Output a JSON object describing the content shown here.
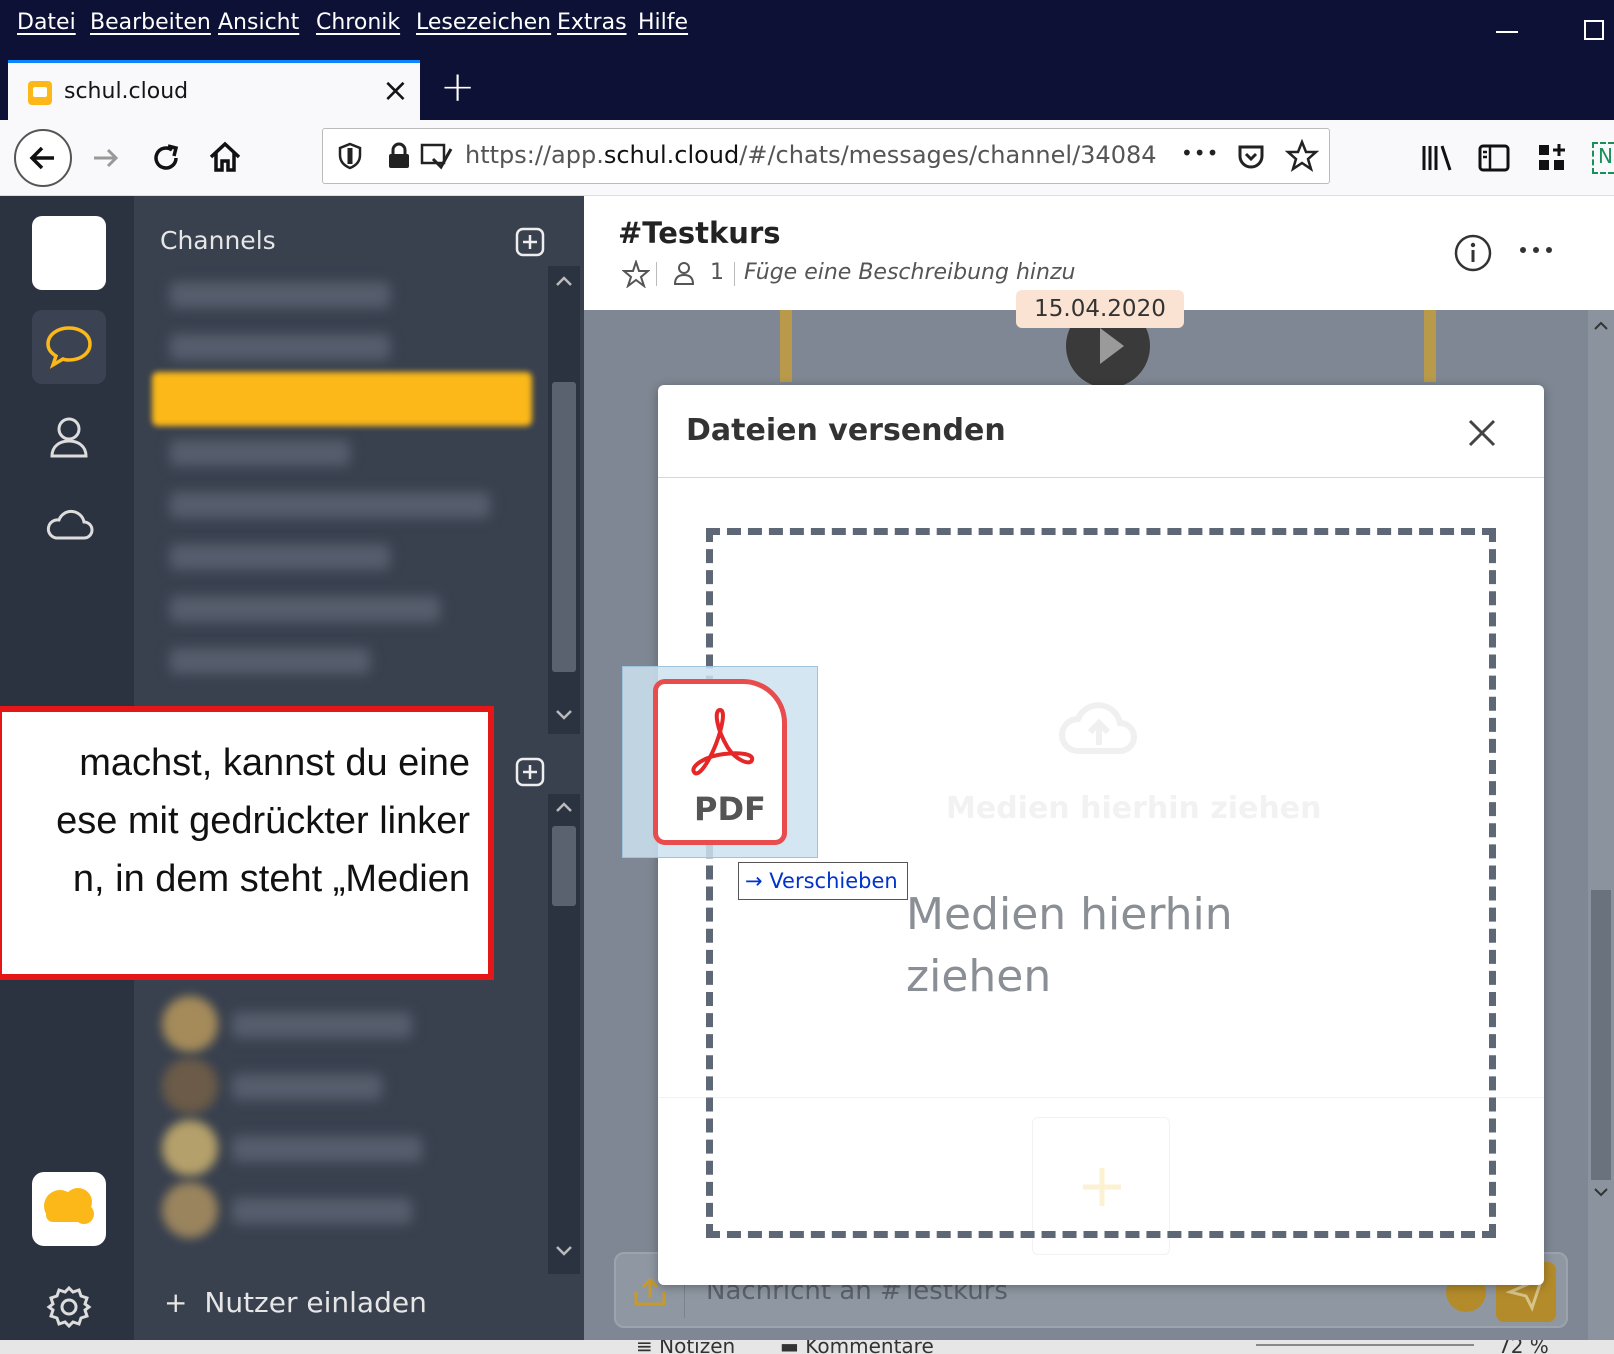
{
  "menu": [
    "Datei",
    "Bearbeiten",
    "Ansicht",
    "Chronik",
    "Lesezeichen",
    "Extras",
    "Hilfe"
  ],
  "tab": {
    "title": "schul.cloud",
    "close": "×",
    "new_tab": "+"
  },
  "url": {
    "prefix": "https://app.",
    "domain": "schul.cloud",
    "path": "/#/chats/messages/channel/34084",
    "more": "•••"
  },
  "sidebar": {
    "channels_title": "Channels",
    "invite_label": "Nutzer einladen",
    "invite_plus": "+"
  },
  "chat": {
    "title": "#Testkurs",
    "member_count": "1",
    "description_placeholder": "Füge eine Beschreibung hinzu",
    "date_badge": "15.04.2020",
    "message_placeholder": "Nachricht an #Testkurs"
  },
  "modal": {
    "title": "Dateien versenden",
    "drop_hint_faded": "Medien hierhin ziehen",
    "drop_hint_line1": "Medien hierhin",
    "drop_hint_line2": "ziehen"
  },
  "drag": {
    "file_label": "PDF",
    "tooltip": "Verschieben"
  },
  "annotation": {
    "line1": "machst, kannst du eine",
    "line2": "ese mit gedrückter linker",
    "line3": "n, in dem steht „Medien"
  },
  "statusbar": {
    "notes": "Notizen",
    "comments": "Kommentare",
    "zoom": "72 %"
  },
  "colors": {
    "accent_yellow": "#fbb818",
    "chrome_dark": "#0c1135",
    "annotation_red": "#e41616"
  }
}
